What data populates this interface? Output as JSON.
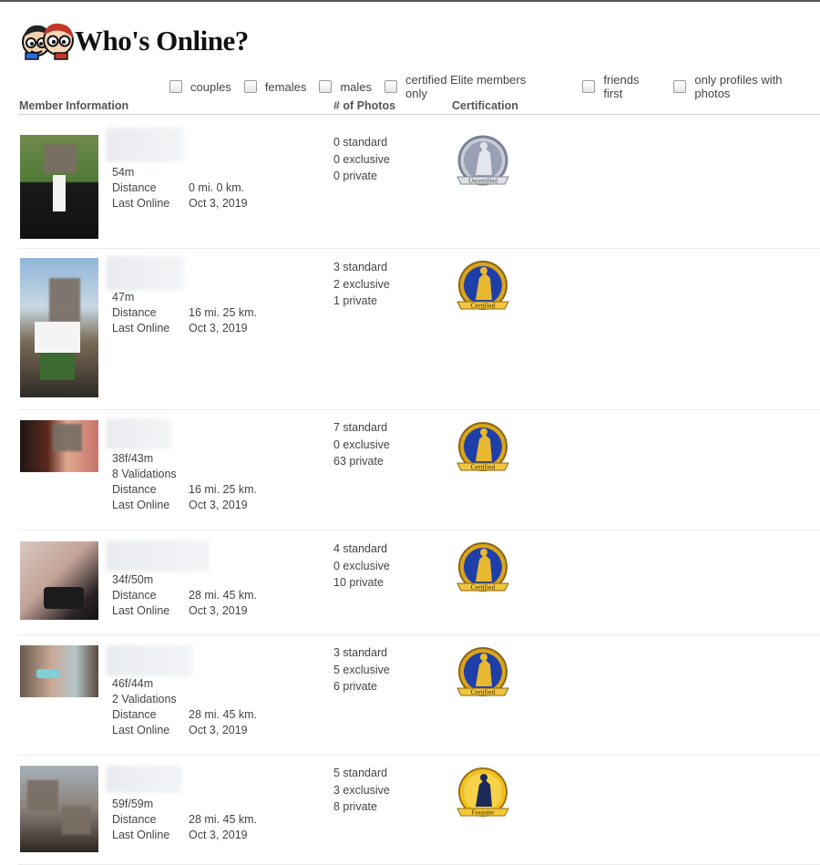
{
  "logo": {
    "text": "Who's Online?"
  },
  "filters": [
    {
      "label": "couples",
      "checked": false
    },
    {
      "label": "females",
      "checked": false
    },
    {
      "label": "males",
      "checked": false
    },
    {
      "label": "certified Elite members only",
      "checked": false
    },
    {
      "label": "friends first",
      "checked": false
    },
    {
      "label": "only profiles with photos",
      "checked": false
    }
  ],
  "table": {
    "headers": {
      "member": "Member Information",
      "photos": "# of Photos",
      "certification": "Certification"
    }
  },
  "members": [
    {
      "age": "54m",
      "validations": "",
      "distance_label": "Distance",
      "distance": "0 mi. 0 km.",
      "last_online_label": "Last Online",
      "last_online": "Oct 3, 2019",
      "standard": "0 standard",
      "exclusive": "0 exclusive",
      "private": "0 private",
      "certification": "Uncertified"
    },
    {
      "age": "47m",
      "validations": "",
      "distance_label": "Distance",
      "distance": "16 mi. 25 km.",
      "last_online_label": "Last Online",
      "last_online": "Oct 3, 2019",
      "standard": "3 standard",
      "exclusive": "2 exclusive",
      "private": "1 private",
      "certification": "Certified"
    },
    {
      "age": "38f/43m",
      "validations": "8 Validations",
      "distance_label": "Distance",
      "distance": "16 mi. 25 km.",
      "last_online_label": "Last Online",
      "last_online": "Oct 3, 2019",
      "standard": "7 standard",
      "exclusive": "0 exclusive",
      "private": "63 private",
      "certification": "Certified"
    },
    {
      "age": "34f/50m",
      "validations": "",
      "distance_label": "Distance",
      "distance": "28 mi. 45 km.",
      "last_online_label": "Last Online",
      "last_online": "Oct 3, 2019",
      "standard": "4 standard",
      "exclusive": "0 exclusive",
      "private": "10 private",
      "certification": "Certified"
    },
    {
      "age": "46f/44m",
      "validations": "2 Validations",
      "distance_label": "Distance",
      "distance": "28 mi. 45 km.",
      "last_online_label": "Last Online",
      "last_online": "Oct 3, 2019",
      "standard": "3 standard",
      "exclusive": "5 exclusive",
      "private": "6 private",
      "certification": "Certified"
    },
    {
      "age": "59f/59m",
      "validations": "",
      "distance_label": "Distance",
      "distance": "28 mi. 45 km.",
      "last_online_label": "Last Online",
      "last_online": "Oct 3, 2019",
      "standard": "5 standard",
      "exclusive": "3 exclusive",
      "private": "8 private",
      "certification": "Founder"
    }
  ],
  "colors": {
    "uncertified_badge": "#9aa0b4",
    "certified_badge": "#1f3fa8",
    "gold_trim": "#d9a520",
    "founder_badge": "#f0c020"
  }
}
